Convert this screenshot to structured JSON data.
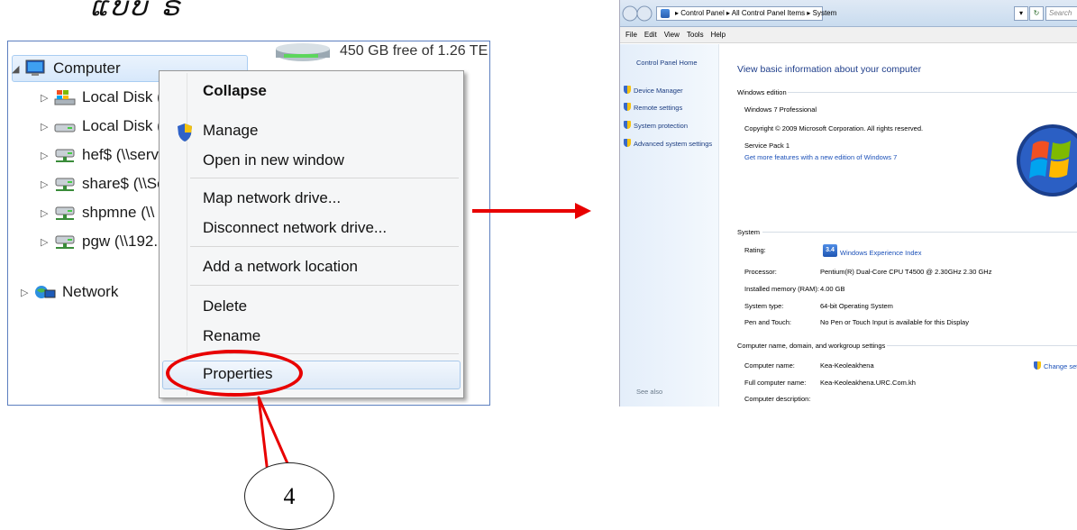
{
  "caption": "ແບບ ຣ",
  "explorer": {
    "drive_info": "450 GB free of 1.26 TE",
    "tree": [
      {
        "label": "Computer",
        "icon": "computer-icon"
      },
      {
        "label": "Local Disk (",
        "icon": "system-drive-icon"
      },
      {
        "label": "Local Disk (",
        "icon": "drive-icon"
      },
      {
        "label": "hef$ (\\\\serv",
        "icon": "network-drive-icon"
      },
      {
        "label": "share$ (\\\\Se",
        "icon": "network-drive-icon"
      },
      {
        "label": "shpmne (\\\\",
        "icon": "network-drive-icon"
      },
      {
        "label": "pgw (\\\\192.",
        "icon": "network-drive-icon"
      },
      {
        "label": "Network",
        "icon": "network-icon"
      }
    ]
  },
  "context_menu": {
    "items": [
      "Collapse",
      "Manage",
      "Open in new window",
      "Map network drive...",
      "Disconnect network drive...",
      "Add a network location",
      "Delete",
      "Rename",
      "Properties"
    ]
  },
  "callout_number": "4",
  "system_window": {
    "breadcrumb": [
      "Control Panel",
      "All Control Panel Items",
      "System"
    ],
    "search_placeholder": "Search",
    "menu": [
      "File",
      "Edit",
      "View",
      "Tools",
      "Help"
    ],
    "sidebar": {
      "home": "Control Panel Home",
      "links": [
        "Device Manager",
        "Remote settings",
        "System protection",
        "Advanced system settings"
      ],
      "see_also": "See also"
    },
    "heading": "View basic information about your computer",
    "edition_section": "Windows edition",
    "edition": "Windows 7 Professional",
    "copyright": "Copyright © 2009 Microsoft Corporation.  All rights reserved.",
    "service_pack": "Service Pack 1",
    "more_features": "Get more features with a new edition of Windows 7",
    "system_section": "System",
    "rating_label": "Rating:",
    "rating_score": "3.4",
    "rating_link": "Windows Experience Index",
    "specs": [
      {
        "label": "Processor:",
        "value": "Pentium(R) Dual-Core CPU     T4500  @ 2.30GHz   2.30 GHz"
      },
      {
        "label": "Installed memory (RAM):",
        "value": "4.00 GB"
      },
      {
        "label": "System type:",
        "value": "64-bit Operating System"
      },
      {
        "label": "Pen and Touch:",
        "value": "No Pen or Touch Input is available for this Display"
      }
    ],
    "name_section": "Computer name, domain, and workgroup settings",
    "names": [
      {
        "label": "Computer name:",
        "value": "Kea-Keoleakhena"
      },
      {
        "label": "Full computer name:",
        "value": "Kea-Keoleakhena.URC.Com.kh"
      },
      {
        "label": "Computer description:",
        "value": ""
      }
    ],
    "change_settings": "Change sett"
  }
}
